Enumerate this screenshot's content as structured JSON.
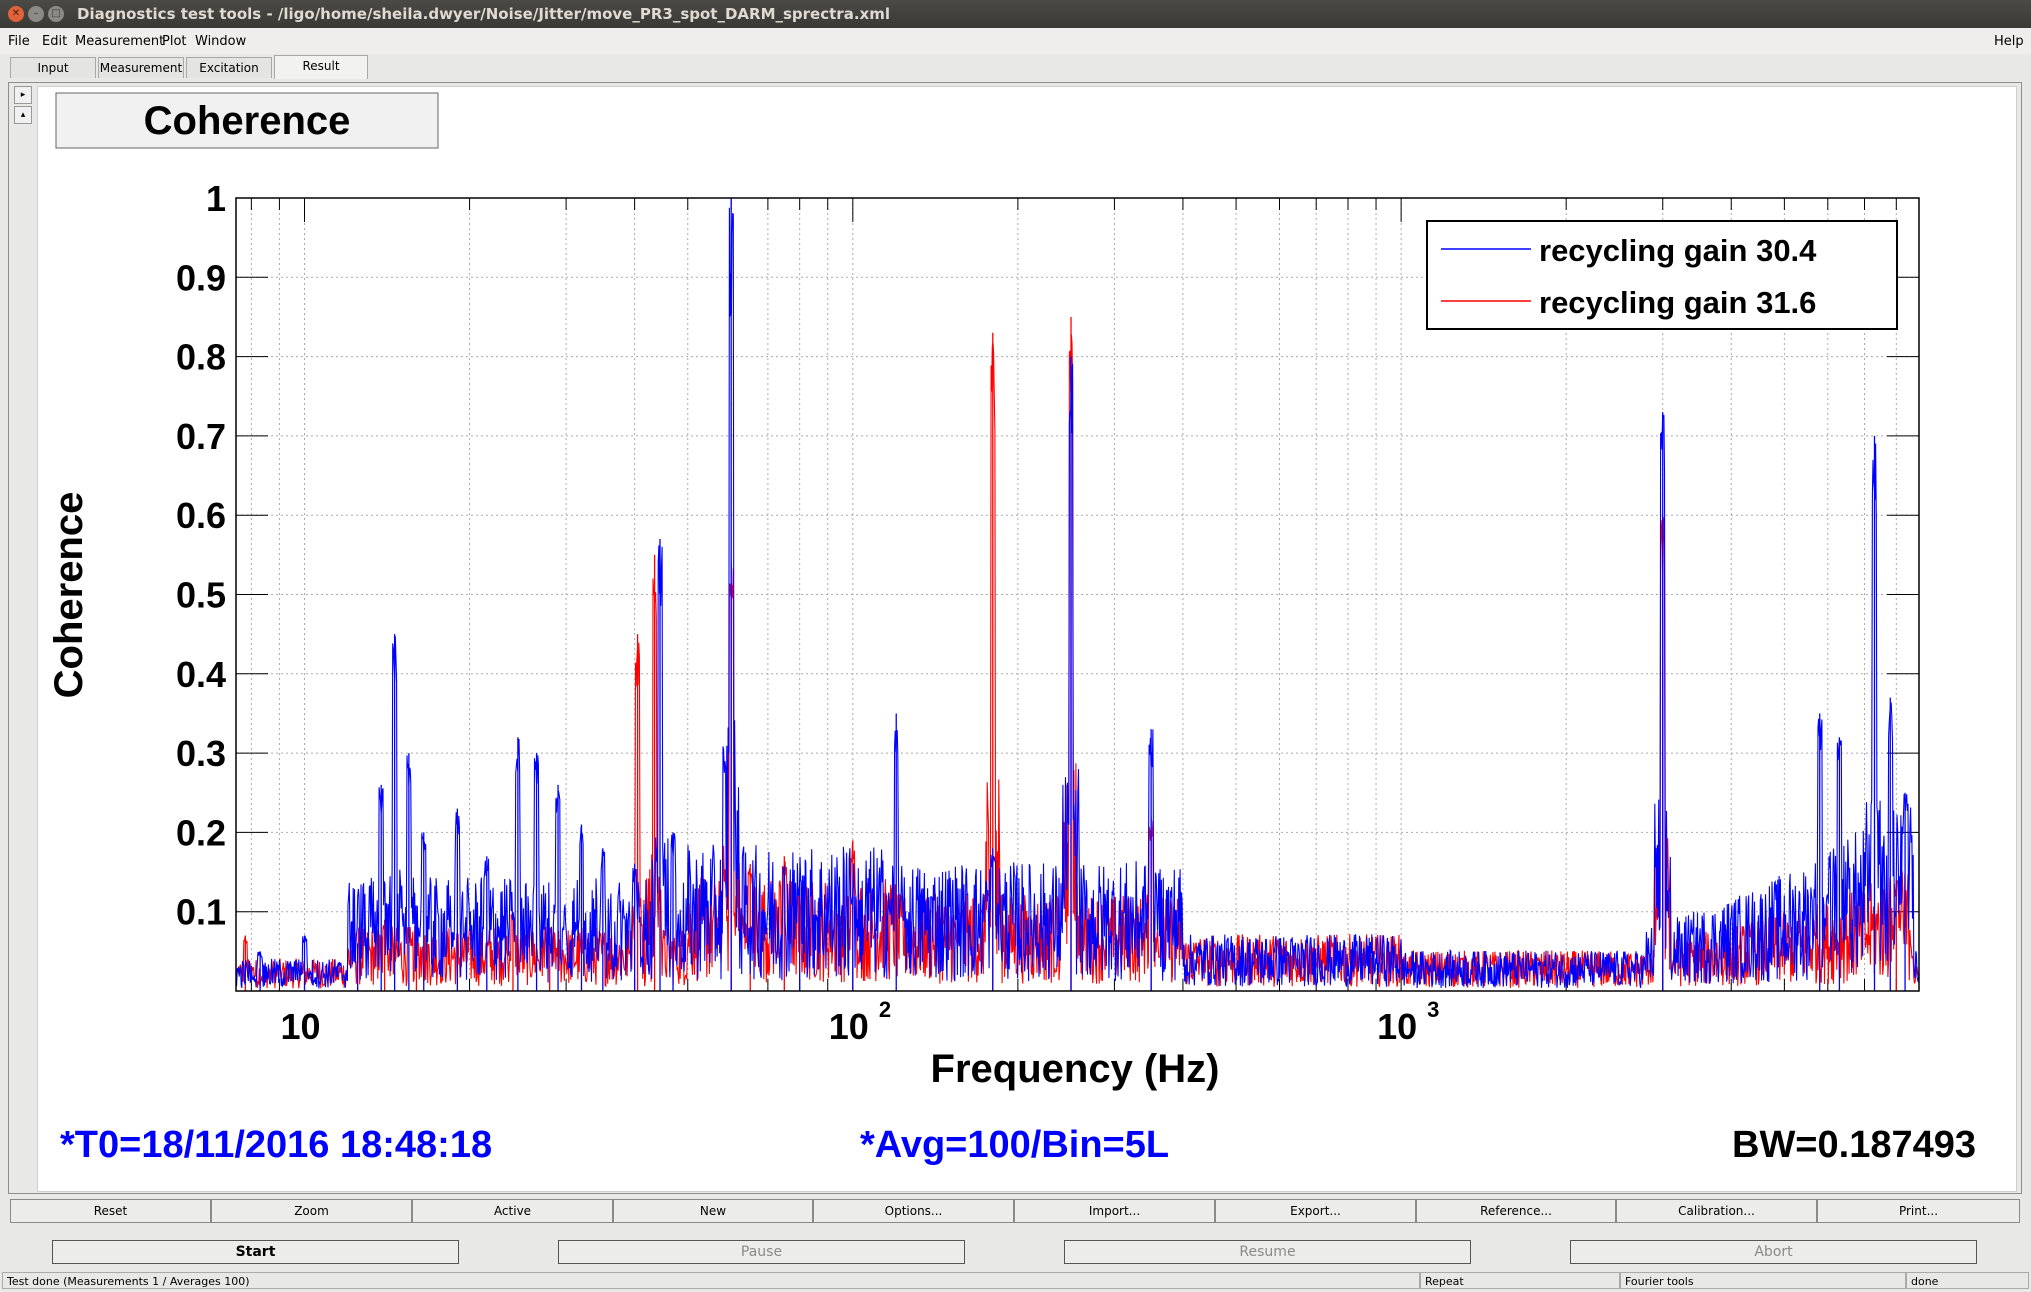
{
  "window": {
    "title": "Diagnostics test tools - /ligo/home/sheila.dwyer/Noise/Jitter/move_PR3_spot_DARM_sprectra.xml"
  },
  "menu": {
    "file": "File",
    "edit": "Edit",
    "measurement": "Measurement",
    "plot": "Plot",
    "window": "Window",
    "help": "Help"
  },
  "tabs": {
    "input": "Input",
    "measurement": "Measurement",
    "excitation": "Excitation",
    "result": "Result"
  },
  "plot": {
    "panel_title": "Coherence",
    "x_axis_label": "Frequency (Hz)",
    "y_axis_label": "Coherence",
    "y_ticks": [
      "1",
      "0.9",
      "0.8",
      "0.7",
      "0.6",
      "0.5",
      "0.4",
      "0.3",
      "0.2",
      "0.1"
    ],
    "x_ticks": [
      {
        "base": "10",
        "exp": ""
      },
      {
        "base": "10",
        "exp": "2"
      },
      {
        "base": "10",
        "exp": "3"
      }
    ],
    "legend": [
      "recycling gain 30.4",
      "recycling gain 31.6"
    ],
    "colors": {
      "series1": "#0000ff",
      "series2": "#ff0000",
      "info": "#0000ff"
    },
    "t0": "*T0=18/11/2016 18:48:18",
    "avg": "*Avg=100/Bin=5L",
    "bw": "BW=0.187493"
  },
  "chart_data": {
    "type": "line",
    "xscale": "log",
    "xlim": [
      7.5,
      8800
    ],
    "ylim": [
      0,
      1
    ],
    "grid": true,
    "legend_position": "top-right",
    "series": [
      {
        "name": "recycling gain 30.4",
        "color": "#0000ff",
        "peaks": [
          {
            "x": 8.3,
            "y": 0.05
          },
          {
            "x": 10,
            "y": 0.07
          },
          {
            "x": 12.5,
            "y": 0.06
          },
          {
            "x": 13.8,
            "y": 0.26
          },
          {
            "x": 14.6,
            "y": 0.45
          },
          {
            "x": 15.5,
            "y": 0.3
          },
          {
            "x": 16.5,
            "y": 0.2
          },
          {
            "x": 19,
            "y": 0.23
          },
          {
            "x": 21.5,
            "y": 0.17
          },
          {
            "x": 24.5,
            "y": 0.32
          },
          {
            "x": 26.5,
            "y": 0.3
          },
          {
            "x": 29,
            "y": 0.26
          },
          {
            "x": 32,
            "y": 0.21
          },
          {
            "x": 35,
            "y": 0.18
          },
          {
            "x": 40,
            "y": 0.16
          },
          {
            "x": 44.5,
            "y": 0.57
          },
          {
            "x": 47,
            "y": 0.2
          },
          {
            "x": 60,
            "y": 1.0
          },
          {
            "x": 80,
            "y": 0.14
          },
          {
            "x": 100,
            "y": 0.12
          },
          {
            "x": 120,
            "y": 0.35
          },
          {
            "x": 180,
            "y": 0.18
          },
          {
            "x": 250,
            "y": 0.8
          },
          {
            "x": 350,
            "y": 0.33
          },
          {
            "x": 3000,
            "y": 0.73
          },
          {
            "x": 5800,
            "y": 0.35
          },
          {
            "x": 6300,
            "y": 0.32
          },
          {
            "x": 7300,
            "y": 0.7
          },
          {
            "x": 7800,
            "y": 0.37
          },
          {
            "x": 8300,
            "y": 0.25
          }
        ]
      },
      {
        "name": "recycling gain 31.6",
        "color": "#ff0000",
        "peaks": [
          {
            "x": 7.8,
            "y": 0.07
          },
          {
            "x": 14,
            "y": 0.09
          },
          {
            "x": 16,
            "y": 0.05
          },
          {
            "x": 24,
            "y": 0.1
          },
          {
            "x": 28,
            "y": 0.08
          },
          {
            "x": 40.5,
            "y": 0.45
          },
          {
            "x": 43.5,
            "y": 0.55
          },
          {
            "x": 60,
            "y": 0.54
          },
          {
            "x": 65,
            "y": 0.16
          },
          {
            "x": 75,
            "y": 0.17
          },
          {
            "x": 100,
            "y": 0.19
          },
          {
            "x": 180,
            "y": 0.83
          },
          {
            "x": 250,
            "y": 0.85
          },
          {
            "x": 350,
            "y": 0.22
          },
          {
            "x": 3000,
            "y": 0.6
          },
          {
            "x": 8000,
            "y": 0.14
          }
        ]
      }
    ]
  },
  "buttons": {
    "reset": "Reset",
    "zoom": "Zoom",
    "active": "Active",
    "new": "New",
    "options": "Options...",
    "import": "Import...",
    "export": "Export...",
    "reference": "Reference...",
    "calibration": "Calibration...",
    "print": "Print..."
  },
  "controls": {
    "start": "Start",
    "pause": "Pause",
    "resume": "Resume",
    "abort": "Abort"
  },
  "status": {
    "message": "Test done (Measurements 1 / Averages 100)",
    "repeat": "Repeat",
    "tool": "Fourier tools",
    "state": "done"
  }
}
